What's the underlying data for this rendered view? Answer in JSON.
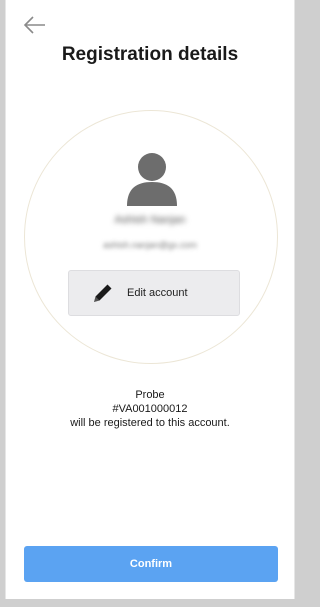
{
  "header": {
    "title": "Registration details"
  },
  "account": {
    "name": "Ashish Nanjan",
    "email": "ashish.nanjan@gx.com",
    "edit_label": "Edit account"
  },
  "probe": {
    "label": "Probe",
    "id": "#VA001000012",
    "message": "will be registered to this account."
  },
  "actions": {
    "confirm_label": "Confirm"
  },
  "colors": {
    "primary": "#5ba3f2",
    "avatar": "#6d6d6d",
    "edit_bg": "#ececee"
  },
  "icons": {
    "back": "back-arrow-icon",
    "avatar": "person-icon",
    "edit": "pencil-icon"
  }
}
